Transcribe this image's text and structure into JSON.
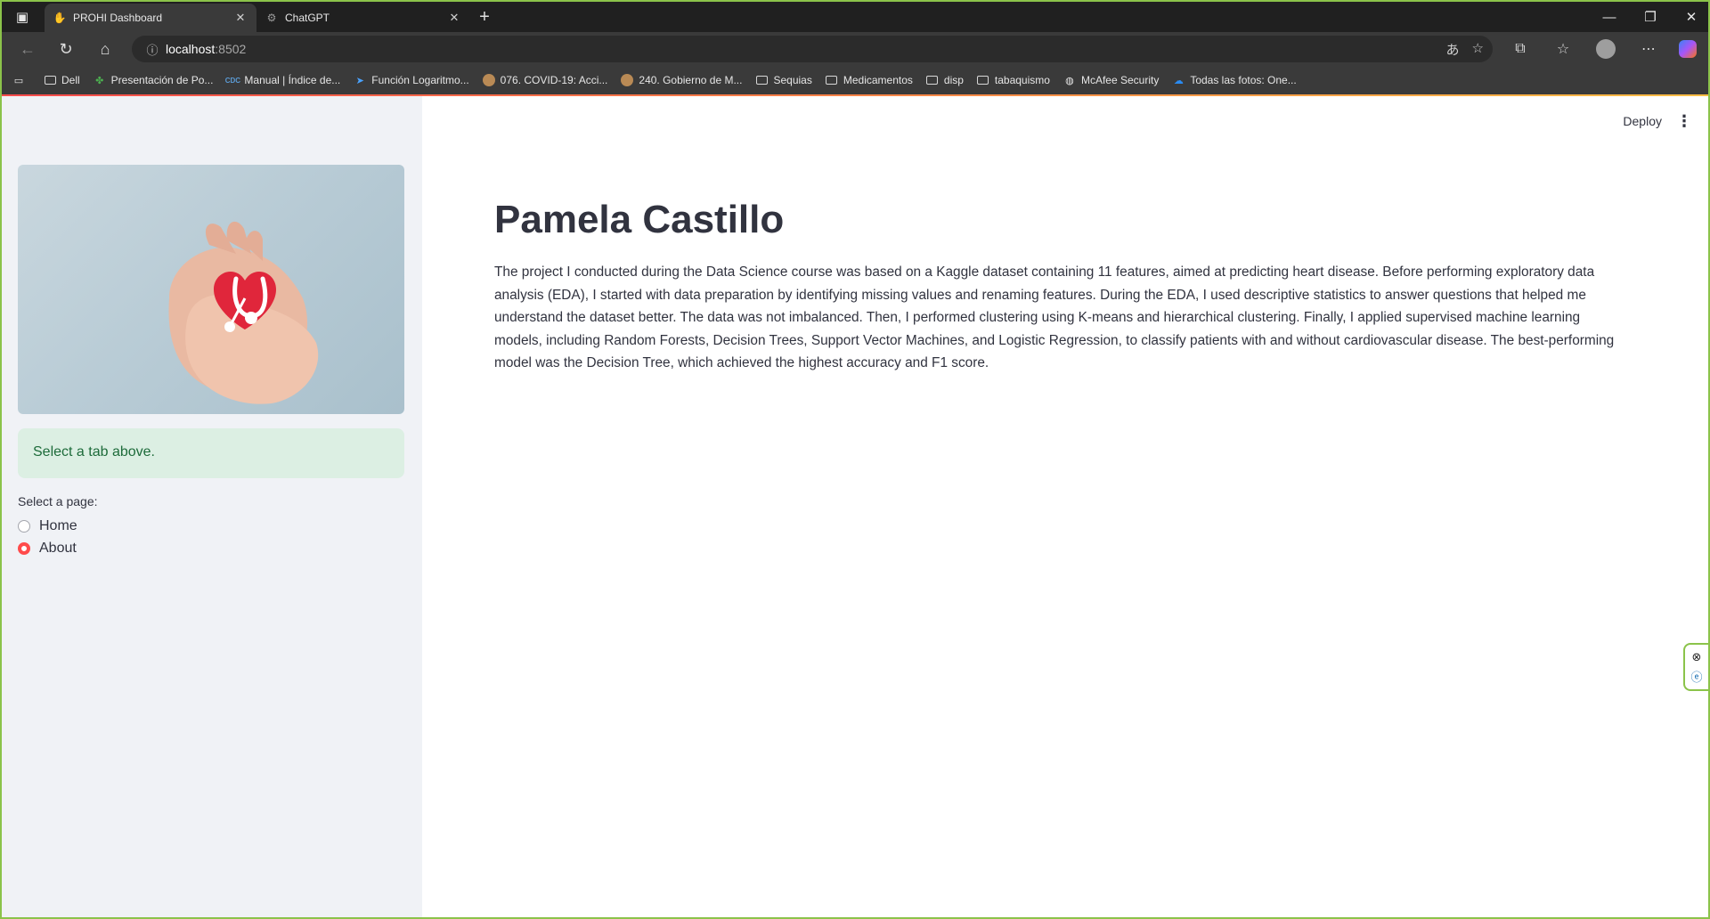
{
  "browser": {
    "tabs": [
      {
        "title": "PROHI Dashboard",
        "active": true,
        "icon": "hand-icon"
      },
      {
        "title": "ChatGPT",
        "active": false,
        "icon": "chatgpt-icon"
      }
    ],
    "address": {
      "host": "localhost",
      "port": ":8502"
    },
    "bookmarks": [
      {
        "label": "Dell",
        "icon": "folder-icon"
      },
      {
        "label": "Presentación de Po...",
        "icon": "clover-icon"
      },
      {
        "label": "Manual | Índice de...",
        "icon": "cdc-icon"
      },
      {
        "label": "Función Logaritmo...",
        "icon": "arrow-icon"
      },
      {
        "label": "076. COVID-19: Acci...",
        "icon": "circle-icon"
      },
      {
        "label": "240. Gobierno de M...",
        "icon": "circle-icon"
      },
      {
        "label": "Sequias",
        "icon": "folder-icon"
      },
      {
        "label": "Medicamentos",
        "icon": "folder-icon"
      },
      {
        "label": "disp",
        "icon": "folder-icon"
      },
      {
        "label": "tabaquismo",
        "icon": "folder-icon"
      },
      {
        "label": "McAfee Security",
        "icon": "globe-icon"
      },
      {
        "label": "Todas las fotos: One...",
        "icon": "cloud-icon"
      }
    ]
  },
  "header": {
    "deploy_label": "Deploy"
  },
  "sidebar": {
    "info_message": "Select a tab above.",
    "radio_label": "Select a page:",
    "options": [
      {
        "label": "Home",
        "selected": false
      },
      {
        "label": "About",
        "selected": true
      }
    ]
  },
  "main": {
    "title": "Pamela Castillo",
    "body": "The project I conducted during the Data Science course was based on a Kaggle dataset containing 11 features, aimed at predicting heart disease. Before performing exploratory data analysis (EDA), I started with data preparation by identifying missing values and renaming features. During the EDA, I used descriptive statistics to answer questions that helped me understand the dataset better. The data was not imbalanced. Then, I performed clustering using K-means and hierarchical clustering. Finally, I applied supervised machine learning models, including Random Forests, Decision Trees, Support Vector Machines, and Logistic Regression, to classify patients with and without cardiovascular disease. The best-performing model was the Decision Tree, which achieved the highest accuracy and F1 score."
  },
  "colors": {
    "accent": "#ff4b4b",
    "info_bg": "#dcefe3",
    "info_text": "#1d6b3a",
    "frame": "#8bc34a"
  }
}
